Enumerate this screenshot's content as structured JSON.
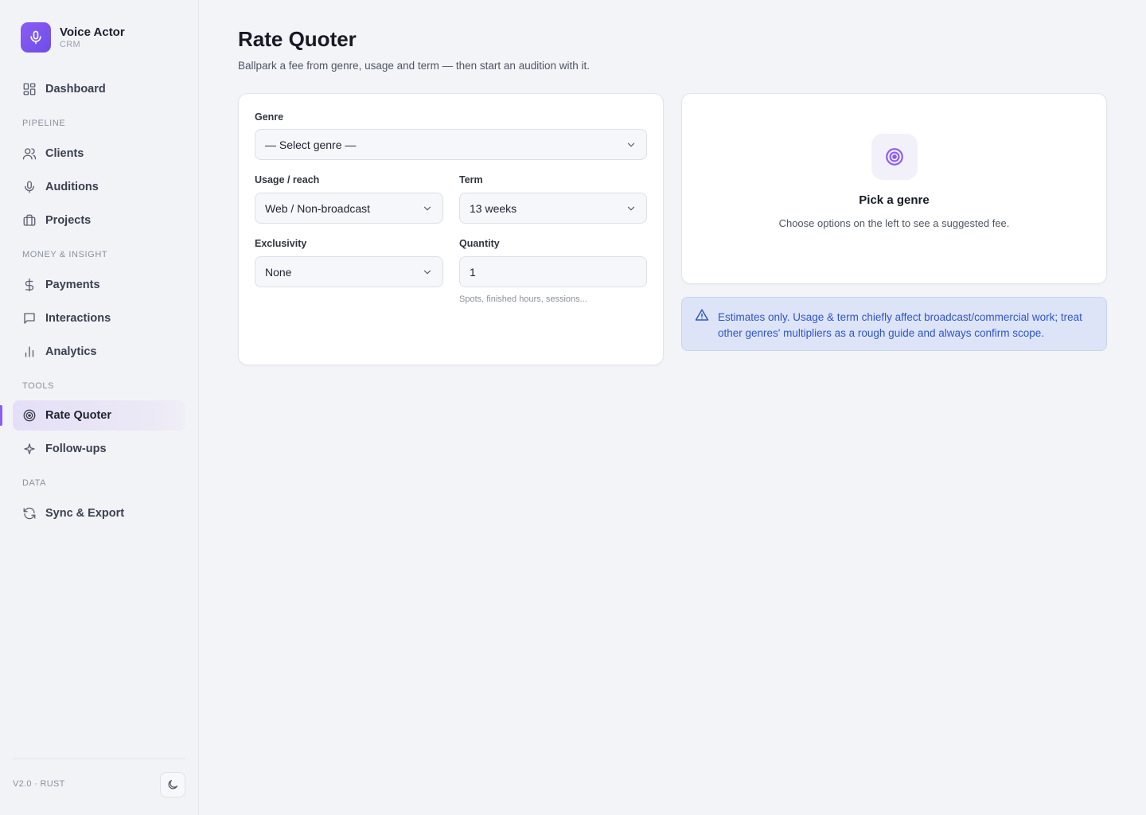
{
  "brand": {
    "name": "Voice Actor",
    "sub": "CRM",
    "icon": "microphone-icon",
    "accent": "#8b5cf6"
  },
  "nav": {
    "dashboard": "Dashboard",
    "sections": {
      "pipeline": "PIPELINE",
      "money": "MONEY & INSIGHT",
      "tools": "TOOLS",
      "data": "DATA"
    },
    "clients": "Clients",
    "auditions": "Auditions",
    "projects": "Projects",
    "payments": "Payments",
    "interactions": "Interactions",
    "analytics": "Analytics",
    "rate_quoter": "Rate Quoter",
    "follow_ups": "Follow-ups",
    "sync_export": "Sync & Export",
    "active": "Rate Quoter"
  },
  "footer": {
    "version": "V2.0 · RUST",
    "theme_icon": "moon-icon"
  },
  "page": {
    "title": "Rate Quoter",
    "subtitle": "Ballpark a fee from genre, usage and term — then start an audition with it."
  },
  "form": {
    "genre": {
      "label": "Genre",
      "value": "— Select genre —"
    },
    "usage": {
      "label": "Usage / reach",
      "value": "Web / Non-broadcast"
    },
    "term": {
      "label": "Term",
      "value": "13 weeks"
    },
    "exclusivity": {
      "label": "Exclusivity",
      "value": "None"
    },
    "quantity": {
      "label": "Quantity",
      "value": "1",
      "hint": "Spots, finished hours, sessions..."
    }
  },
  "result": {
    "icon": "target-icon",
    "title": "Pick a genre",
    "text": "Choose options on the left to see a suggested fee."
  },
  "notice": {
    "icon": "warning-icon",
    "text": "Estimates only. Usage & term chiefly affect broadcast/commercial work; treat other genres' multipliers as a rough guide and always confirm scope.",
    "color": "#2f56c9"
  }
}
